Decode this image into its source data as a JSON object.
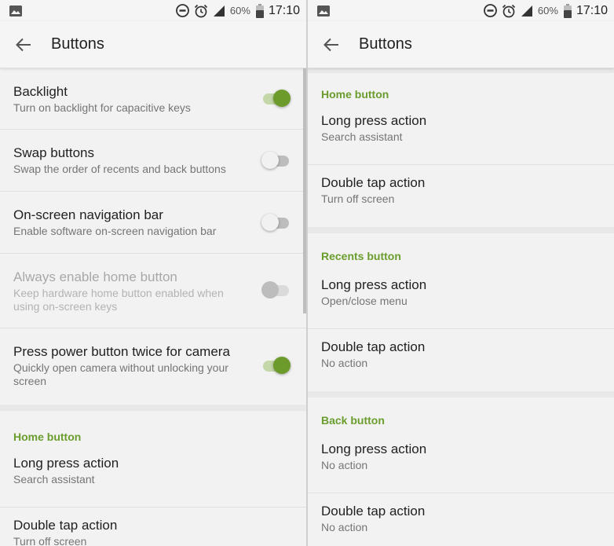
{
  "status": {
    "battery": "60%",
    "time": "17:10"
  },
  "left": {
    "title": "Buttons",
    "items": [
      {
        "title": "Backlight",
        "sub": "Turn on backlight for capacitive keys",
        "toggle": "on"
      },
      {
        "title": "Swap buttons",
        "sub": "Swap the order of recents and back buttons",
        "toggle": "off"
      },
      {
        "title": "On-screen navigation bar",
        "sub": "Enable software on-screen navigation bar",
        "toggle": "off"
      },
      {
        "title": "Always enable home button",
        "sub": "Keep hardware home button enabled when using on-screen keys",
        "toggle": "disabled"
      },
      {
        "title": "Press power button twice for camera",
        "sub": "Quickly open camera without unlocking your screen",
        "toggle": "on"
      }
    ],
    "home_section": {
      "header": "Home button",
      "long_title": "Long press action",
      "long_value": "Search assistant",
      "double_title": "Double tap action",
      "double_value": "Turn off screen"
    }
  },
  "right": {
    "title": "Buttons",
    "sections": [
      {
        "header": "Home button",
        "long_title": "Long press action",
        "long_value": "Search assistant",
        "double_title": "Double tap action",
        "double_value": "Turn off screen"
      },
      {
        "header": "Recents button",
        "long_title": "Long press action",
        "long_value": "Open/close menu",
        "double_title": "Double tap action",
        "double_value": "No action"
      },
      {
        "header": "Back button",
        "long_title": "Long press action",
        "long_value": "No action",
        "double_title": "Double tap action",
        "double_value": "No action"
      }
    ]
  },
  "colors": {
    "accent": "#6a9d2d",
    "switch_on": "#6c9b2b",
    "background": "#f2f2f2"
  },
  "icons": [
    "image-icon",
    "dnd-icon",
    "alarm-icon",
    "signal-icon",
    "battery-icon",
    "back-arrow-icon"
  ]
}
